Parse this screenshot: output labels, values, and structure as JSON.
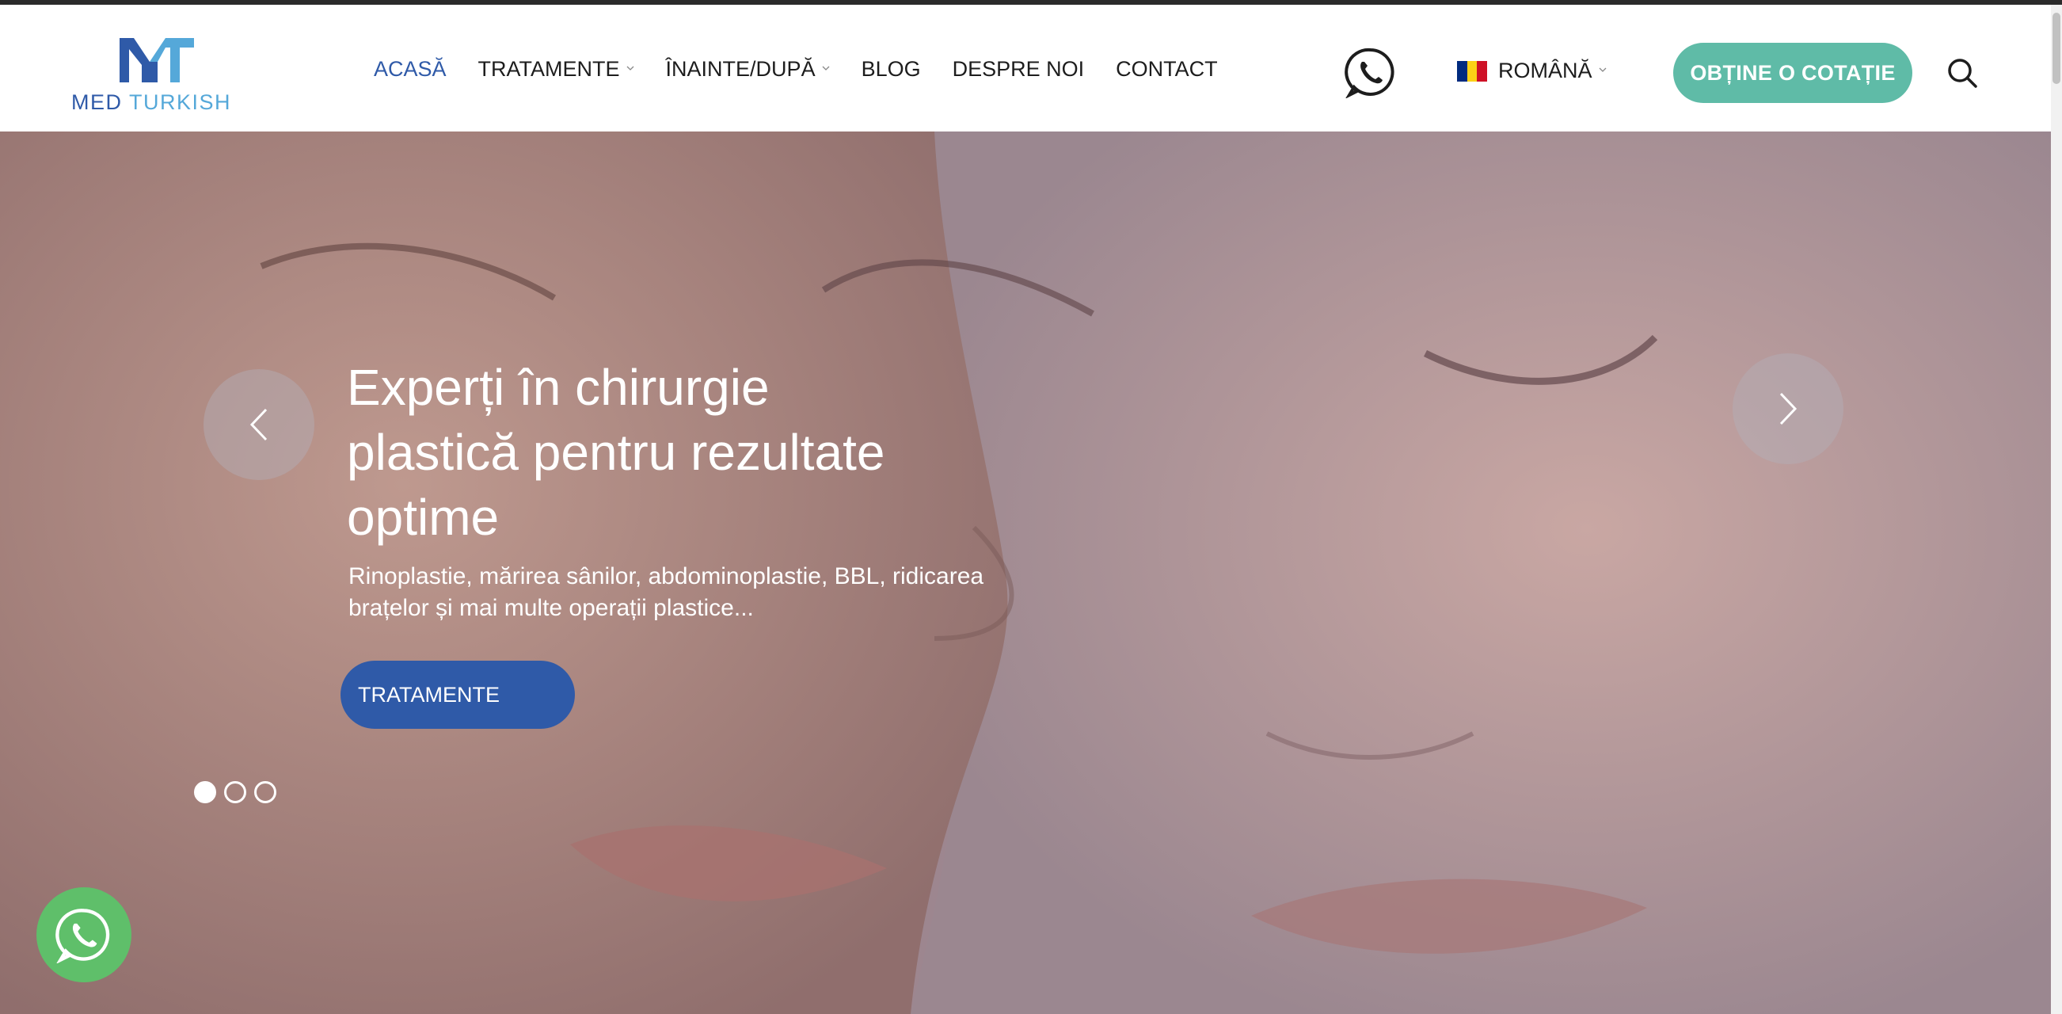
{
  "brand": {
    "name_part1": "MED",
    "name_part2": "TURKISH",
    "colors": {
      "primary": "#2f5aa8",
      "light": "#55a8d9",
      "accent": "#5fbba7"
    }
  },
  "nav": {
    "items": [
      {
        "label": "ACASĂ",
        "active": true,
        "has_dropdown": false
      },
      {
        "label": "TRATAMENTE",
        "active": false,
        "has_dropdown": true
      },
      {
        "label": "ÎNAINTE/DUPĂ",
        "active": false,
        "has_dropdown": true
      },
      {
        "label": "BLOG",
        "active": false,
        "has_dropdown": false
      },
      {
        "label": "DESPRE NOI",
        "active": false,
        "has_dropdown": false
      },
      {
        "label": "CONTACT",
        "active": false,
        "has_dropdown": false
      }
    ]
  },
  "header": {
    "whatsapp_icon": "whatsapp-icon",
    "language": {
      "label": "ROMÂNĂ",
      "flag_icon": "romania-flag-icon"
    },
    "quote_button": "OBȚINE O COTAȚIE",
    "search_icon": "search-icon"
  },
  "hero": {
    "title_lines": [
      "Experți în chirurgie",
      "plastică pentru rezultate",
      "optime"
    ],
    "subtitle_lines": [
      "Rinoplastie, mărirea sânilor, abdominoplastie, BBL, ridicarea",
      "brațelor și mai multe operații plastice..."
    ],
    "button_label": "TRATAMENTE",
    "prev_icon": "chevron-left-icon",
    "next_icon": "chevron-right-icon",
    "slides_total": 3,
    "active_slide": 1
  },
  "floating": {
    "whatsapp_icon": "whatsapp-icon"
  }
}
